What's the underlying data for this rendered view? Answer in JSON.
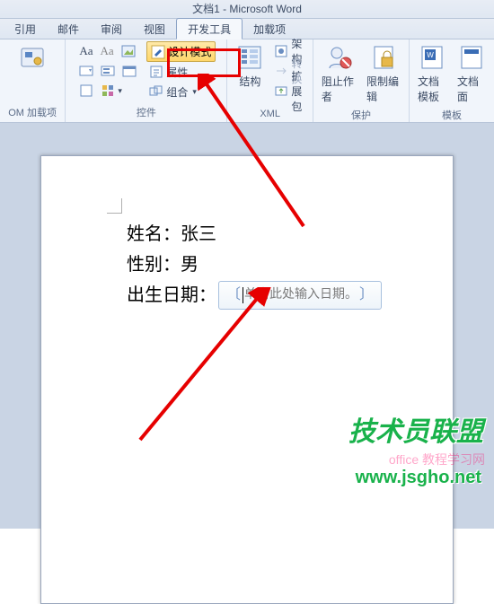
{
  "title": "文档1 - Microsoft Word",
  "tabs": {
    "t0": "引用",
    "t1": "邮件",
    "t2": "审阅",
    "t3": "视图",
    "t4": "开发工具",
    "t5": "加载项"
  },
  "ribbon": {
    "addins": {
      "label": "OM 加载项"
    },
    "controls": {
      "group_label": "控件",
      "aa1": "Aa",
      "aa2": "Aa",
      "design_mode": "设计模式",
      "properties": "属性",
      "group_btn": "组合"
    },
    "xml": {
      "group_label": "XML",
      "structure": "结构",
      "schema": "架构",
      "transform": "转换",
      "expansion": "扩展包"
    },
    "protect": {
      "group_label": "保护",
      "block_authors": "阻止作者",
      "restrict_edit": "限制编辑"
    },
    "templates": {
      "group_label": "模板",
      "doc_template": "文档模板",
      "doc_panel": "文档面"
    }
  },
  "form": {
    "name_label": "姓名：",
    "name_value": "张三",
    "gender_label": "性别：",
    "gender_value": "男",
    "dob_label": "出生日期：",
    "date_placeholder": "单击此处输入日期。"
  },
  "watermark": {
    "main": "技术员联盟",
    "url": "www.jsgho.net",
    "faint": "office 教程学习网"
  }
}
